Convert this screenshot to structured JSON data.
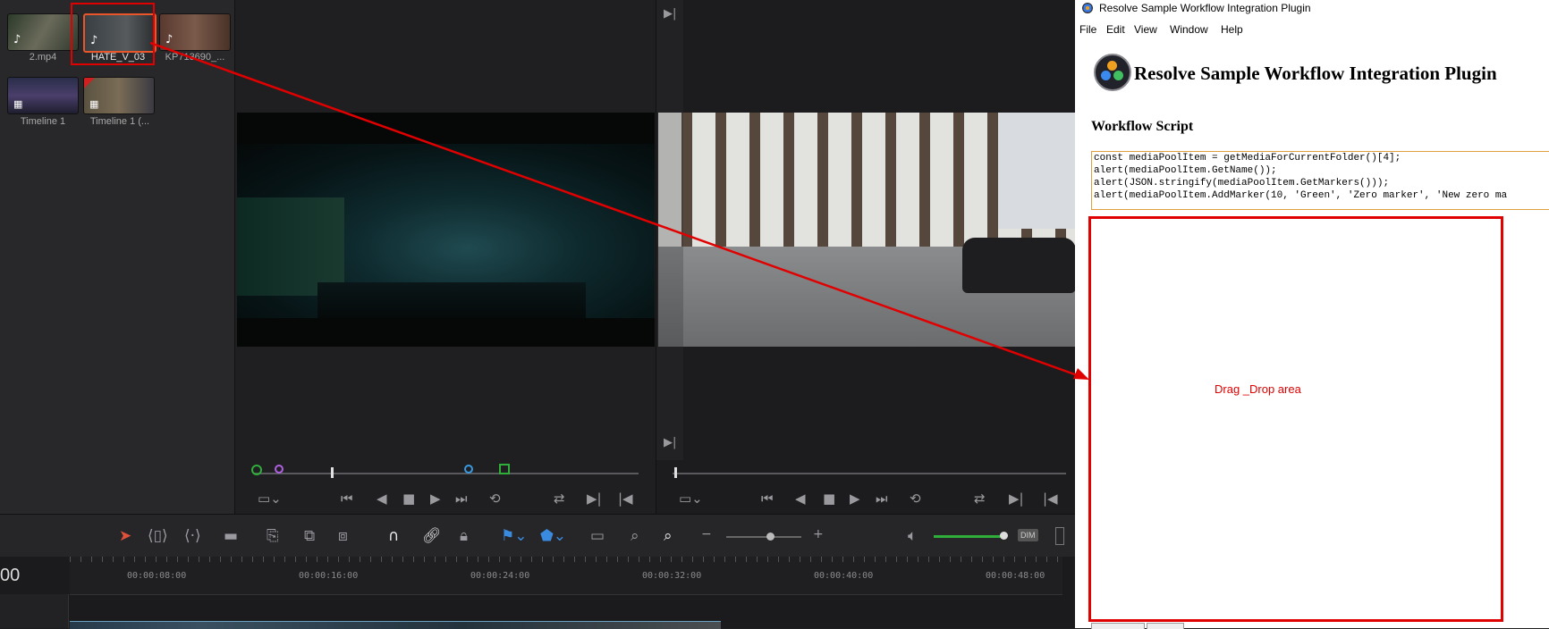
{
  "media_pool": {
    "clips": [
      {
        "label": "2.mp4",
        "has_audio": true
      },
      {
        "label": "HATE_V_03",
        "has_audio": true,
        "selected": true
      },
      {
        "label": "KP713690_...",
        "has_audio": true
      },
      {
        "label": "Timeline 1",
        "type": "timeline"
      },
      {
        "label": "Timeline 1 (...",
        "type": "timeline"
      }
    ]
  },
  "timeline": {
    "current_time_partial": "00",
    "ruler_marks": [
      "00:00:08:00",
      "00:00:16:00",
      "00:00:24:00",
      "00:00:32:00",
      "00:00:40:00",
      "00:00:48:00"
    ]
  },
  "toolbar": {
    "dim_label": "DIM"
  },
  "plugin": {
    "window_title": "Resolve Sample Workflow Integration Plugin",
    "menu": [
      "File",
      "Edit",
      "View",
      "Window",
      "Help"
    ],
    "heading": "Resolve Sample Workflow Integration Plugin",
    "script_label": "Workflow Script",
    "script_lines": [
      "const mediaPoolItem = getMediaForCurrentFolder()[4];",
      "alert(mediaPoolItem.GetName());",
      "alert(JSON.stringify(mediaPoolItem.GetMarkers()));",
      "alert(mediaPoolItem.AddMarker(10, 'Green', 'Zero marker', 'New zero ma"
    ],
    "drop_label": "Drag _Drop area"
  },
  "colors": {
    "annotation_red": "#e00000",
    "accent_green": "#2fae3a",
    "code_border": "#e0a040"
  }
}
